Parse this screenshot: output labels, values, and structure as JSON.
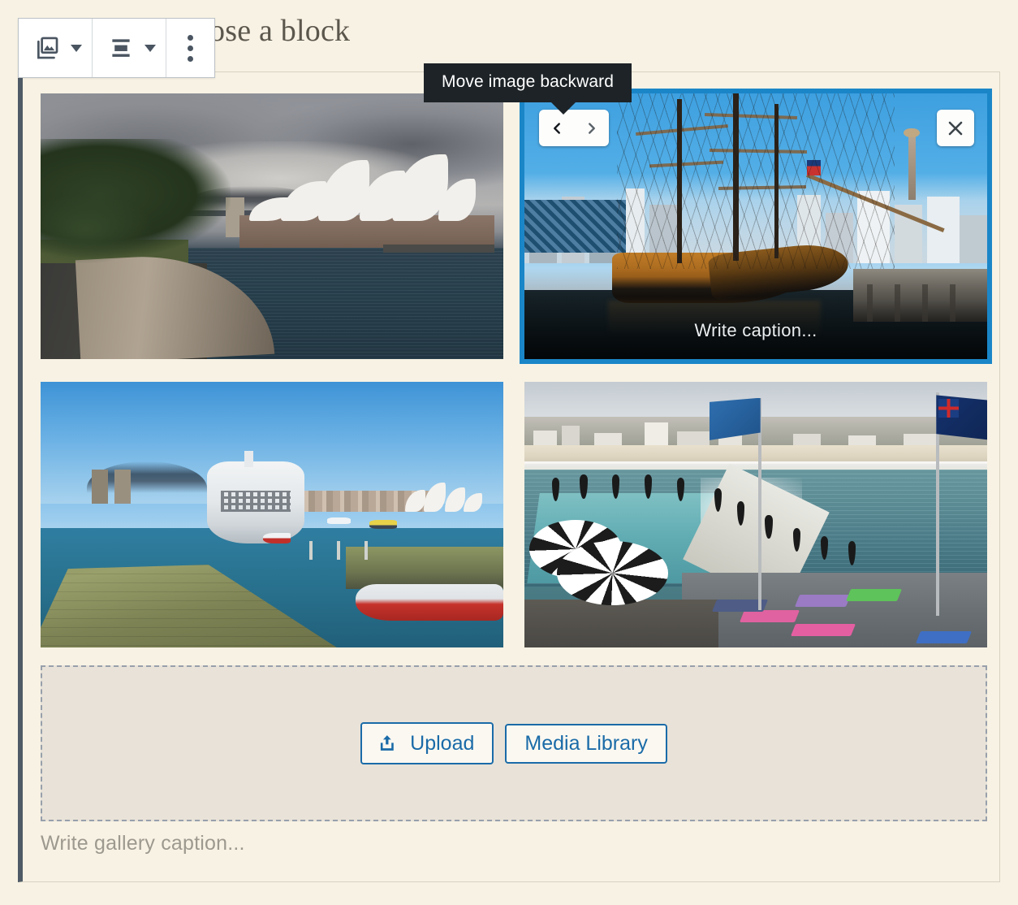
{
  "editor": {
    "ghost_text": "r type / to choose a block"
  },
  "toolbar": {
    "block_type_label": "gallery-block-type",
    "block_type_icon": "gallery-icon",
    "block_type_caret": "chevron-down-icon",
    "align_label": "align-options",
    "align_icon": "align-center-icon",
    "align_caret": "chevron-down-icon",
    "more_label": "more-options",
    "more_icon": "three-dots-vertical-icon"
  },
  "tooltip": {
    "text": "Move image backward"
  },
  "gallery": {
    "images": [
      {
        "alt": "Sydney Opera House and Harbour Bridge under storm clouds",
        "selected": false,
        "caption_placeholder": "Write caption..."
      },
      {
        "alt": "Tall ship HMB Endeavour moored at Darling Harbour",
        "selected": true,
        "caption_placeholder": "Write caption..."
      },
      {
        "alt": "Cruise ship at Circular Quay with Harbour Bridge and Opera House",
        "selected": false,
        "caption_placeholder": "Write caption..."
      },
      {
        "alt": "Bondi Icebergs pool with flags and yoga mats",
        "selected": false,
        "caption_placeholder": "Write caption..."
      }
    ],
    "controls": {
      "move_backward": "Move image backward",
      "move_forward": "Move image forward",
      "remove": "Remove image"
    },
    "caption_placeholder": "Write gallery caption..."
  },
  "dropzone": {
    "upload_label": "Upload",
    "upload_icon": "upload-icon",
    "media_library_label": "Media Library"
  },
  "colors": {
    "selection_blue": "#1a86c8",
    "link_blue": "#1a6ba8",
    "tooltip_bg": "#1d2327",
    "canvas_bg": "#f8f2e4",
    "dropzone_bg": "#e8e2d8",
    "block_border": "#4f5b66"
  }
}
